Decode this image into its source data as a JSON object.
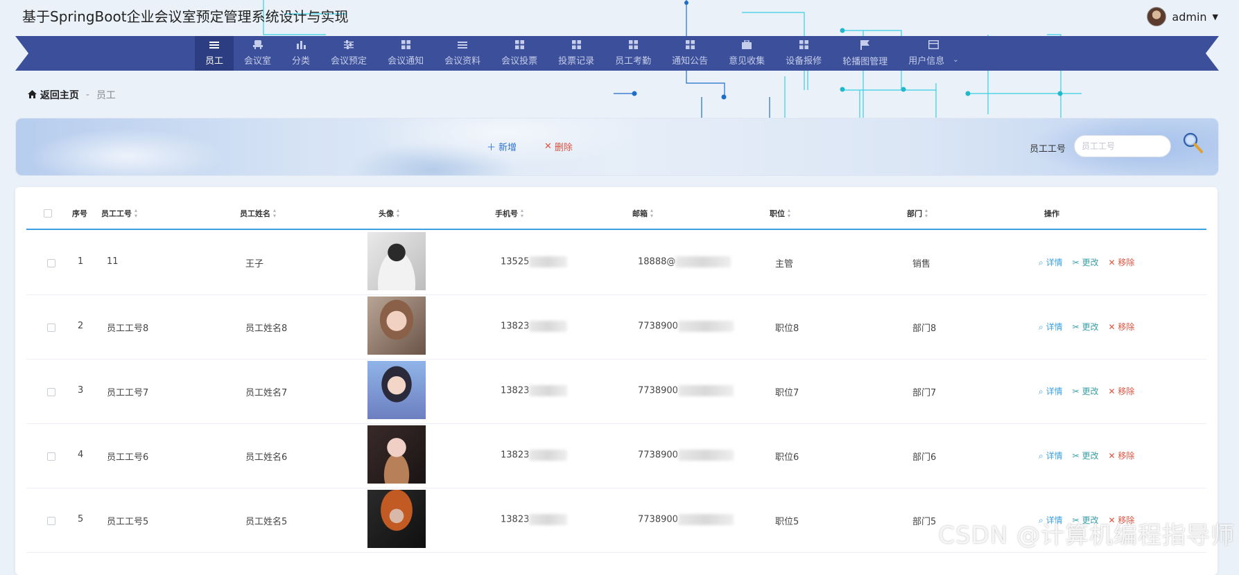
{
  "app_title": "基于SpringBoot企业会议室预定管理系统设计与实现",
  "user": {
    "name": "admin"
  },
  "nav": [
    {
      "label": "员工",
      "icon": "list-icon",
      "active": true
    },
    {
      "label": "会议室",
      "icon": "chair-icon"
    },
    {
      "label": "分类",
      "icon": "bar-chart-icon"
    },
    {
      "label": "会议预定",
      "icon": "sliders-icon"
    },
    {
      "label": "会议通知",
      "icon": "grid-icon"
    },
    {
      "label": "会议资料",
      "icon": "list-icon"
    },
    {
      "label": "会议投票",
      "icon": "grid-icon"
    },
    {
      "label": "投票记录",
      "icon": "grid-icon"
    },
    {
      "label": "员工考勤",
      "icon": "grid-icon"
    },
    {
      "label": "通知公告",
      "icon": "grid-icon"
    },
    {
      "label": "意见收集",
      "icon": "briefcase-icon"
    },
    {
      "label": "设备报修",
      "icon": "grid-icon"
    },
    {
      "label": "轮播图管理",
      "icon": "flag-icon"
    },
    {
      "label": "用户信息",
      "icon": "window-icon",
      "has_submenu": true
    }
  ],
  "breadcrumb": {
    "home": "返回主页",
    "sep": "-",
    "current": "员工"
  },
  "actions": {
    "add": "新增",
    "delete": "删除"
  },
  "search": {
    "label": "员工工号",
    "placeholder": "员工工号"
  },
  "table": {
    "headers": [
      "序号",
      "员工工号",
      "员工姓名",
      "头像",
      "手机号",
      "邮箱",
      "职位",
      "部门",
      "操作"
    ],
    "ops": {
      "detail": "详情",
      "edit": "更改",
      "remove": "移除"
    },
    "rows": [
      {
        "no": "1",
        "emp_id": "11",
        "name": "王子",
        "phone": "13525",
        "email": "18888@",
        "position": "主管",
        "dept": "销售"
      },
      {
        "no": "2",
        "emp_id": "员工工号8",
        "name": "员工姓名8",
        "phone": "13823",
        "email": "7738900",
        "position": "职位8",
        "dept": "部门8"
      },
      {
        "no": "3",
        "emp_id": "员工工号7",
        "name": "员工姓名7",
        "phone": "13823",
        "email": "7738900",
        "position": "职位7",
        "dept": "部门7"
      },
      {
        "no": "4",
        "emp_id": "员工工号6",
        "name": "员工姓名6",
        "phone": "13823",
        "email": "7738900",
        "position": "职位6",
        "dept": "部门6"
      },
      {
        "no": "5",
        "emp_id": "员工工号5",
        "name": "员工姓名5",
        "phone": "13823",
        "email": "7738900",
        "position": "职位5",
        "dept": "部门5"
      }
    ]
  },
  "watermark": "CSDN @计算机编程指导师"
}
